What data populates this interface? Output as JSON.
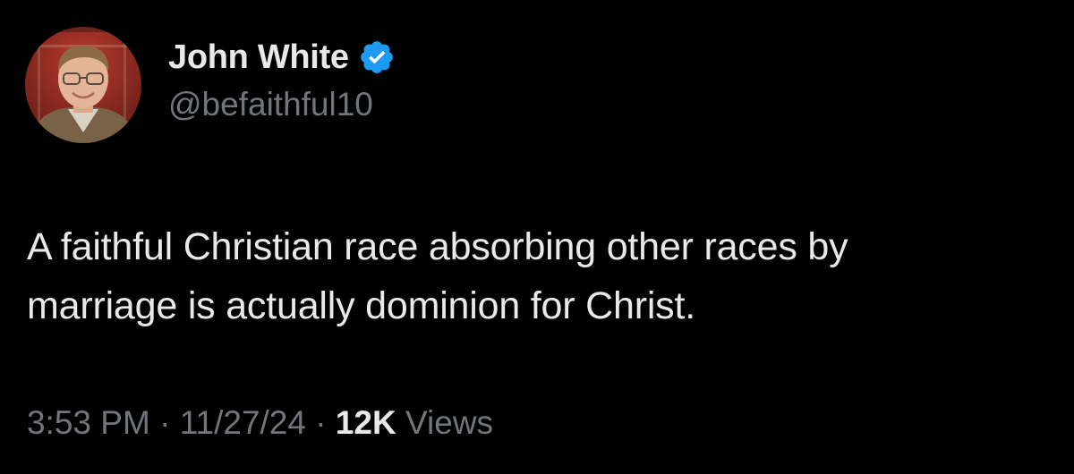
{
  "author": {
    "name": "John White",
    "handle": "@befaithful10",
    "verified": true,
    "verified_icon": "verified-badge-icon",
    "verified_color": "#1d9bf0"
  },
  "tweet": {
    "text_line1": "A faithful Christian race absorbing other races by",
    "text_line2": "marriage is actually dominion for Christ."
  },
  "meta": {
    "time": "3:53 PM",
    "separator1": " · ",
    "date": "11/27/24",
    "separator2": " · ",
    "views_count": "12K",
    "views_label": " Views"
  },
  "colors": {
    "background": "#000000",
    "primary_text": "#e7e9ea",
    "secondary_text": "#71767b"
  }
}
